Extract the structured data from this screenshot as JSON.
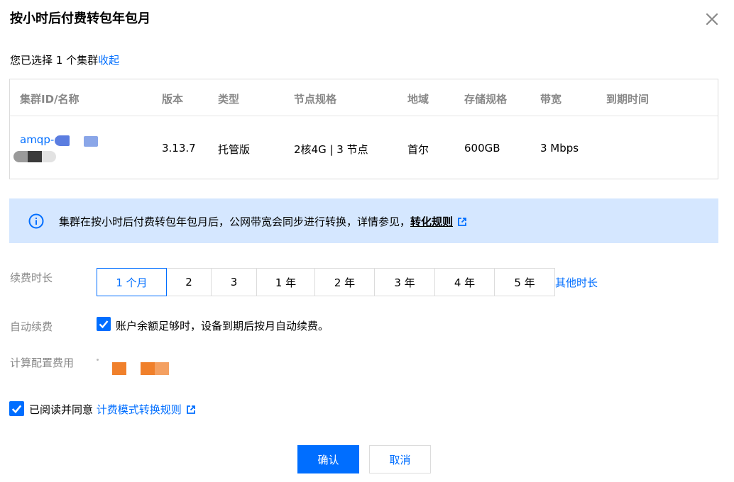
{
  "dialog": {
    "title": "按小时后付费转包年包月"
  },
  "selection": {
    "summary": "您已选择 1 个集群",
    "collapse_label": "收起"
  },
  "table": {
    "headers": [
      "集群ID/名称",
      "版本",
      "类型",
      "节点规格",
      "地域",
      "存储规格",
      "带宽",
      "到期时间"
    ],
    "row": {
      "cluster_id_prefix": "amqp-",
      "version": "3.13.7",
      "type": "托管版",
      "node_spec": "2核4G | 3 节点",
      "region": "首尔",
      "storage": "600GB",
      "bandwidth": "3 Mbps",
      "expiry": ""
    }
  },
  "notice": {
    "text": "集群在按小时后付费转包年包月后，公网带宽会同步进行转换，详情参见，",
    "link_label": "转化规则"
  },
  "renewal": {
    "label": "续费时长",
    "options": [
      "1 个月",
      "2",
      "3",
      "1 年",
      "2 年",
      "3 年",
      "4 年",
      "5 年"
    ],
    "selected": "1 个月",
    "other_label": "其他时长"
  },
  "auto_renew": {
    "label": "自动续费",
    "checked": true,
    "text": "账户余额足够时，设备到期后按月自动续费。"
  },
  "cost": {
    "label": "计算配置费用"
  },
  "agreement": {
    "checked": true,
    "text": "已阅读并同意",
    "link_label": "计费模式转换规则"
  },
  "buttons": {
    "confirm": "确认",
    "cancel": "取消"
  },
  "colors": {
    "primary": "#006eff",
    "notice_bg": "#d5e7ff",
    "cost_mask": "#f0802b"
  }
}
